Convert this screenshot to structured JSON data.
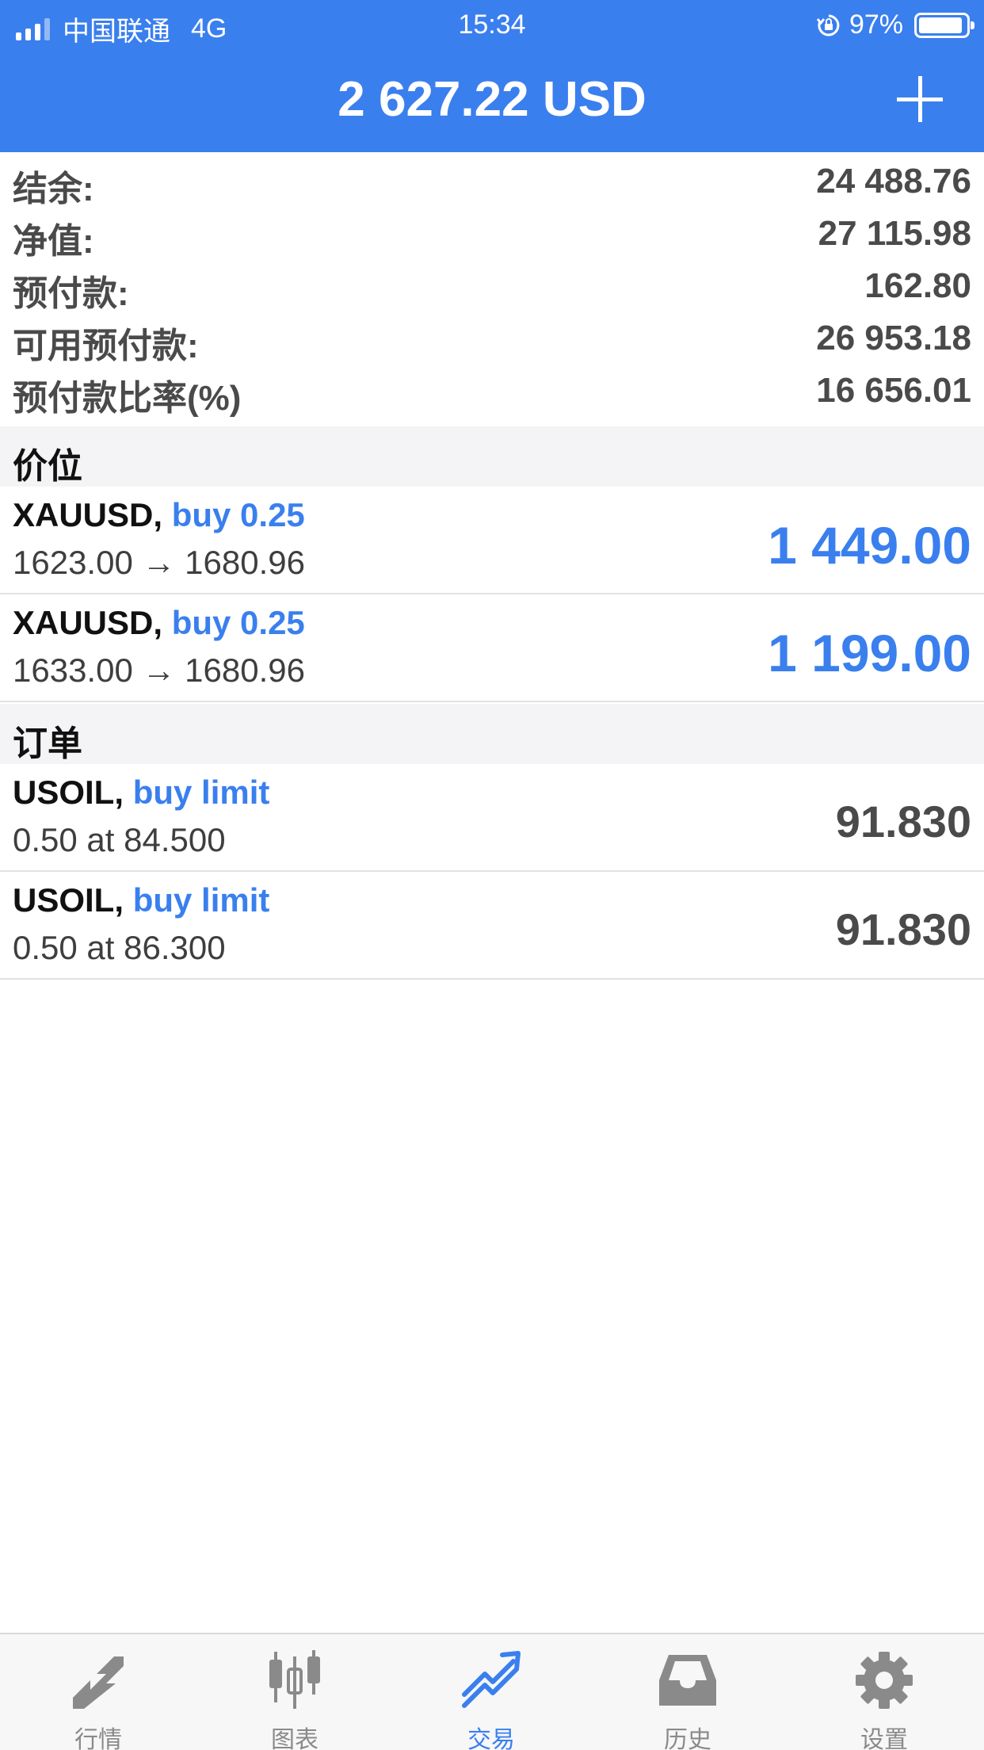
{
  "status_bar": {
    "carrier": "中国联通",
    "network": "4G",
    "time": "15:34",
    "battery": "97%"
  },
  "header": {
    "title": "2 627.22 USD",
    "add_icon": "plus-icon"
  },
  "summary": [
    {
      "label": "结余:",
      "value": "24 488.76"
    },
    {
      "label": "净值:",
      "value": "27 115.98"
    },
    {
      "label": "预付款:",
      "value": "162.80"
    },
    {
      "label": "可用预付款:",
      "value": "26 953.18"
    },
    {
      "label": "预付款比率(%)",
      "value": "16 656.01"
    }
  ],
  "positions": {
    "title": "价位",
    "items": [
      {
        "symbol": "XAUUSD,",
        "direction": "buy 0.25",
        "prices": "1623.00 → 1680.96",
        "profit": "1 449.00"
      },
      {
        "symbol": "XAUUSD,",
        "direction": "buy 0.25",
        "prices": "1633.00 → 1680.96",
        "profit": "1 199.00"
      }
    ]
  },
  "orders": {
    "title": "订单",
    "items": [
      {
        "symbol": "USOIL,",
        "direction": "buy limit",
        "detail": "0.50 at 84.500",
        "price": "91.830"
      },
      {
        "symbol": "USOIL,",
        "direction": "buy limit",
        "detail": "0.50 at 86.300",
        "price": "91.830"
      }
    ]
  },
  "tabs": [
    {
      "label": "行情",
      "icon": "quotes-arrows-icon",
      "active": false
    },
    {
      "label": "图表",
      "icon": "candlestick-chart-icon",
      "active": false
    },
    {
      "label": "交易",
      "icon": "trade-trend-icon",
      "active": true
    },
    {
      "label": "历史",
      "icon": "history-inbox-icon",
      "active": false
    },
    {
      "label": "设置",
      "icon": "gear-icon",
      "active": false
    }
  ],
  "colors": {
    "accent": "#3a7fee",
    "tab_inactive": "#8a8a8a"
  }
}
